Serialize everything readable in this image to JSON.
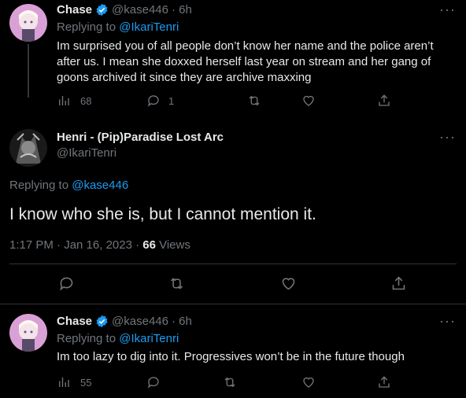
{
  "tweet1": {
    "name": "Chase",
    "handle": "@kase446",
    "time": "· 6h",
    "replying_prefix": "Replying to ",
    "replying_to": "@IkariTenri",
    "text": "Im surprised you of all people don’t know her name and the police aren’t after us. I mean she doxxed herself last year on stream and her gang of goons archived it since they are archive maxxing",
    "views": "68",
    "replies": "1"
  },
  "main_tweet": {
    "name": "Henri - (Pip)Paradise Lost Arc",
    "handle": "@IkariTenri",
    "replying_prefix": "Replying to ",
    "replying_to": "@kase446",
    "text": "I know who she is, but I cannot mention it.",
    "timestamp": "1:17 PM · Jan 16, 2023 · ",
    "views_count": "66",
    "views_label": " Views"
  },
  "tweet3": {
    "name": "Chase",
    "handle": "@kase446",
    "time": "· 6h",
    "replying_prefix": "Replying to ",
    "replying_to": "@IkariTenri",
    "text": "Im too lazy to dig into it. Progressives won’t be in the future though",
    "views": "55"
  },
  "colors": {
    "accent": "#1d9bf0",
    "verified": "#1d9bf0",
    "muted": "#71767b",
    "background": "#000000"
  },
  "more_glyph": "···"
}
